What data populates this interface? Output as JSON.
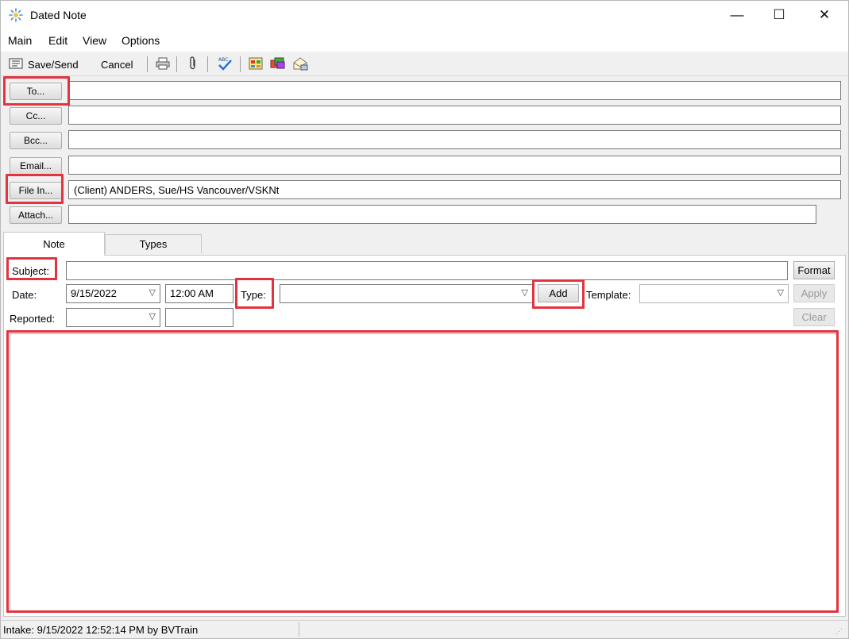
{
  "window": {
    "title": "Dated Note",
    "controls": {
      "minimize": "—",
      "maximize": "☐",
      "close": "✕"
    }
  },
  "menu": [
    "Main",
    "Edit",
    "View",
    "Options"
  ],
  "toolbar": {
    "save_send": "Save/Send",
    "cancel": "Cancel",
    "icons": [
      "print-icon",
      "attach-paperclip-icon",
      "spellcheck-icon",
      "calendar-icon",
      "cards-icon",
      "letter-icon"
    ]
  },
  "address": {
    "to_button": "To...",
    "to_value": "",
    "cc_button": "Cc...",
    "cc_value": "",
    "bcc_button": "Bcc...",
    "bcc_value": "",
    "email_button": "Email...",
    "email_value": "",
    "filein_button": "File In...",
    "filein_value": "(Client) ANDERS, Sue/HS Vancouver/VSKNt",
    "attach_button": "Attach...",
    "attach_value": ""
  },
  "tabs": {
    "note": "Note",
    "types": "Types"
  },
  "form": {
    "subject_label": "Subject:",
    "subject_value": "",
    "format_button": "Format",
    "date_label": "Date:",
    "date_value": "9/15/2022",
    "time_value": "12:00 AM",
    "type_label": "Type:",
    "type_value": "",
    "add_button": "Add",
    "template_label": "Template:",
    "template_value": "",
    "apply_button": "Apply",
    "reported_label": "Reported:",
    "reported_value": "",
    "reported_extra": "",
    "clear_button": "Clear"
  },
  "status": {
    "text": "Intake: 9/15/2022 12:52:14 PM by BVTrain",
    "grip": "⋰"
  },
  "colors": {
    "highlight": "#e2343f",
    "frame": "#f0f0f0"
  }
}
